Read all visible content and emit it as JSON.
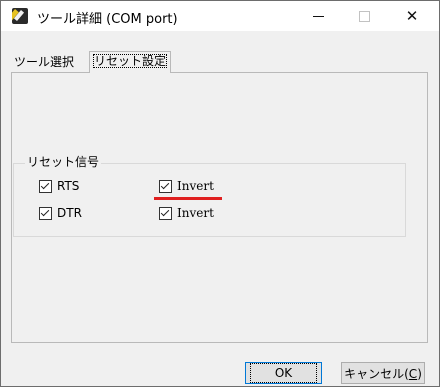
{
  "window": {
    "title": "ツール詳細 (COM port)",
    "minimize_glyph": "—",
    "maximize_glyph": "□",
    "close_glyph": "✕"
  },
  "tabs": [
    {
      "label": "ツール選択",
      "active": false
    },
    {
      "label": "リセット設定",
      "active": true
    }
  ],
  "reset_group": {
    "label": "リセット信号",
    "rows": [
      {
        "signal": "RTS",
        "signal_checked": true,
        "invert_label": "Invert",
        "invert_checked": true
      },
      {
        "signal": "DTR",
        "signal_checked": true,
        "invert_label": "Invert",
        "invert_checked": true
      }
    ]
  },
  "buttons": {
    "ok_label": "OK",
    "ok_mnemonic": "O",
    "cancel_label": "キャンセル(",
    "cancel_mnemonic": "C",
    "cancel_suffix": ")"
  },
  "colors": {
    "annotation_underline": "#e02020",
    "default_button_border": "#0078d7"
  },
  "icons": {
    "app": "app-icon",
    "minimize": "minimize-icon",
    "maximize": "maximize-icon",
    "close": "close-icon",
    "checkbox": "checkbox-checked-icon"
  }
}
